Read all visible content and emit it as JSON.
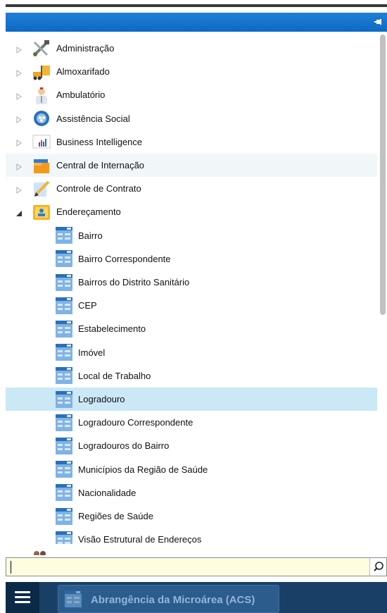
{
  "tree": {
    "top_items": [
      {
        "label": "Administração",
        "icon": "tools-icon",
        "expanded": false
      },
      {
        "label": "Almoxarifado",
        "icon": "forklift-icon",
        "expanded": false
      },
      {
        "label": "Ambulatório",
        "icon": "doctor-icon",
        "expanded": false
      },
      {
        "label": "Assistência Social",
        "icon": "globe-icon",
        "expanded": false
      },
      {
        "label": "Business Intelligence",
        "icon": "bar-chart-icon",
        "expanded": false
      },
      {
        "label": "Central de Internação",
        "icon": "folders-icon",
        "expanded": false
      },
      {
        "label": "Controle de Contrato",
        "icon": "pencil-icon",
        "expanded": false
      },
      {
        "label": "Endereçamento",
        "icon": "address-map-icon",
        "expanded": true
      }
    ],
    "children": [
      {
        "label": "Bairro"
      },
      {
        "label": "Bairro Correspondente"
      },
      {
        "label": "Bairros do Distrito Sanitário"
      },
      {
        "label": "CEP"
      },
      {
        "label": "Estabelecimento"
      },
      {
        "label": "Imóvel"
      },
      {
        "label": "Local de Trabalho"
      },
      {
        "label": "Logradouro",
        "selected": true
      },
      {
        "label": "Logradouro Correspondente"
      },
      {
        "label": "Logradouros do Bairro"
      },
      {
        "label": "Municípios da Região de Saúde"
      },
      {
        "label": "Nacionalidade"
      },
      {
        "label": "Regiões de Saúde"
      },
      {
        "label": "Visão Estrutural de Endereços"
      }
    ]
  },
  "search": {
    "value": "",
    "placeholder": ""
  },
  "taskbar": {
    "task_label": "Abrangência da Microárea (ACS)"
  },
  "colors": {
    "header": "#1a76d2",
    "selected_row": "#cbe8f6",
    "search_bg": "#fffde0",
    "taskbar": "#1a3f66"
  }
}
